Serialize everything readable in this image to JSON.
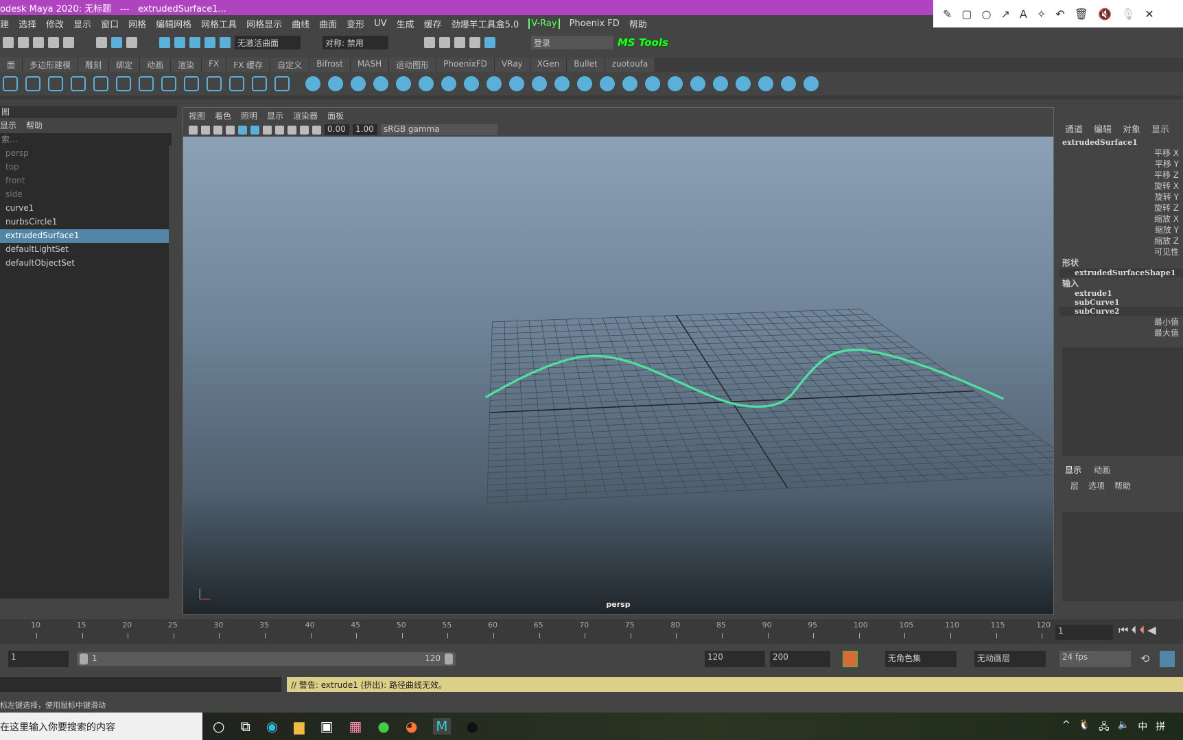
{
  "title": "odesk Maya 2020: 无标题   ---   extrudedSurface1...",
  "annotation_tools": [
    "pencil-icon",
    "rectangle-icon",
    "circle-icon",
    "arrow-icon",
    "text-icon",
    "magic-icon",
    "undo-icon",
    "trash-icon",
    "mute-icon",
    "mic-off-icon",
    "close-icon"
  ],
  "menu": [
    "建",
    "选择",
    "修改",
    "显示",
    "窗口",
    "网格",
    "编辑网格",
    "网格工具",
    "网格显示",
    "曲线",
    "曲面",
    "变形",
    "UV",
    "生成",
    "缓存",
    "劲爆羊工具盒5.0",
    "V-Ray",
    "Phoenix FD",
    "帮助"
  ],
  "toolbar": {
    "live_surface": "无激活曲面",
    "symmetry": "对称: 禁用",
    "login": "登录",
    "ms_tools": "MS Tools"
  },
  "shelf_tabs": [
    "面",
    "多边形建模",
    "雕刻",
    "绑定",
    "动画",
    "渲染",
    "FX",
    "FX 缓存",
    "自定义",
    "Bifrost",
    "MASH",
    "运动图形",
    "PhoenixFD",
    "VRay",
    "XGen",
    "Bullet",
    "zuotoufa"
  ],
  "outliner": {
    "header": "图",
    "menu": [
      "显示",
      "帮助"
    ],
    "search_placeholder": "索...",
    "items": [
      {
        "label": "persp",
        "dim": true
      },
      {
        "label": "top",
        "dim": true
      },
      {
        "label": "front",
        "dim": true
      },
      {
        "label": "side",
        "dim": true
      },
      {
        "label": "curve1"
      },
      {
        "label": "nurbsCircle1"
      },
      {
        "label": "extrudedSurface1",
        "selected": true
      },
      {
        "label": "defaultLightSet"
      },
      {
        "label": "defaultObjectSet"
      }
    ]
  },
  "viewport": {
    "menu": [
      "视图",
      "着色",
      "照明",
      "显示",
      "渲染器",
      "面板"
    ],
    "exposure": "0.00",
    "gamma": "1.00",
    "color_space": "sRGB gamma",
    "camera": "persp",
    "curve_color": "#4fe0a0"
  },
  "channel_box": {
    "menu": [
      "通道",
      "编辑",
      "对象",
      "显示"
    ],
    "object": "extrudedSurface1",
    "attrs": [
      "平移 X",
      "平移 Y",
      "平移 Z",
      "旋转 X",
      "旋转 Y",
      "旋转 Z",
      "缩放 X",
      "缩放 Y",
      "缩放 Z",
      "可见性"
    ],
    "shape_label": "形状",
    "shape": "extrudedSurfaceShape1",
    "inputs_label": "输入",
    "inputs": [
      "extrude1",
      "subCurve1",
      "subCurve2"
    ],
    "min": "最小值",
    "max": "最大值",
    "layer_tabs": [
      "显示",
      "动画"
    ],
    "layer_menu": [
      "层",
      "选项",
      "帮助"
    ]
  },
  "timeline": {
    "ticks": [
      10,
      15,
      20,
      25,
      30,
      35,
      40,
      45,
      50,
      55,
      60,
      65,
      70,
      75,
      80,
      85,
      90,
      95,
      100,
      105,
      110,
      115,
      120
    ],
    "current_frame": "1"
  },
  "range": {
    "start": "1",
    "range_start": "1",
    "range_end": "120",
    "end": "120",
    "anim_end": "200",
    "char_set": "无角色集",
    "anim_layer": "无动画层",
    "fps": "24 fps"
  },
  "command": {
    "warning": "// 警告: extrude1 (挤出): 路径曲线无效。"
  },
  "help_line": "标左键选择，使用鼠标中键滑动",
  "taskbar": {
    "search": "在这里输入你要搜索的内容",
    "ime1": "中",
    "ime2": "拼"
  }
}
